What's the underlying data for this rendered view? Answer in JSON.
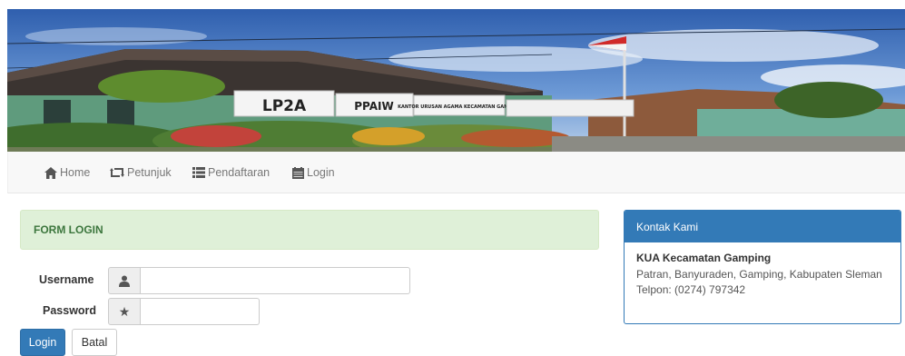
{
  "banner": {
    "signs": [
      "LP2A",
      "PPAIW",
      "KANTOR URUSAN AGAMA KECAMATAN GAMPING"
    ]
  },
  "navbar": {
    "items": [
      {
        "label": "Home",
        "icon": "home-icon"
      },
      {
        "label": "Petunjuk",
        "icon": "retweet-icon"
      },
      {
        "label": "Pendaftaran",
        "icon": "list-icon"
      },
      {
        "label": "Login",
        "icon": "calendar-icon"
      }
    ]
  },
  "login_form": {
    "heading": "FORM LOGIN",
    "username_label": "Username",
    "username_value": "",
    "password_label": "Password",
    "password_value": "",
    "submit_label": "Login",
    "cancel_label": "Batal"
  },
  "contact": {
    "heading": "Kontak Kami",
    "org": "KUA Kecamatan Gamping",
    "address": "Patran, Banyuraden, Gamping, Kabupaten Sleman",
    "phone": "Telpon: (0274) 797342"
  },
  "colors": {
    "primary": "#337ab7",
    "success_bg": "#dff0d8",
    "success_text": "#3c763d",
    "navbar_bg": "#f8f8f8"
  }
}
